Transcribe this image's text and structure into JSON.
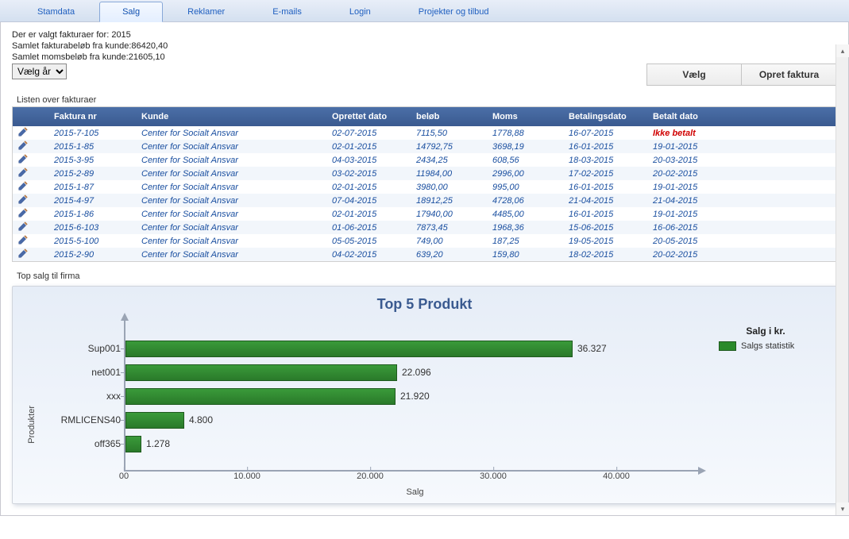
{
  "tabs": [
    {
      "label": "Stamdata",
      "active": false
    },
    {
      "label": "Salg",
      "active": true
    },
    {
      "label": "Reklamer",
      "active": false
    },
    {
      "label": "E-mails",
      "active": false
    },
    {
      "label": "Login",
      "active": false
    },
    {
      "label": "Projekter og tilbud",
      "active": false
    }
  ],
  "info": {
    "selected_year_line": "Der er valgt fakturaer for: 2015",
    "total_invoice": "Samlet fakturabeløb fra kunde:86420,40",
    "total_vat": "Samlet momsbeløb fra kunde:21605,10"
  },
  "year_select": {
    "value": "Vælg år"
  },
  "buttons": {
    "choose": "Vælg",
    "new_invoice": "Opret faktura"
  },
  "list_label": "Listen over fakturaer",
  "columns": {
    "faktura": "Faktura nr",
    "kunde": "Kunde",
    "oprettet": "Oprettet dato",
    "belob": "beløb",
    "moms": "Moms",
    "betalingsdato": "Betalingsdato",
    "betalt": "Betalt dato"
  },
  "not_paid_label": "Ikke betalt",
  "rows": [
    {
      "nr": "2015-7-105",
      "kunde": "Center for Socialt Ansvar",
      "oprettet": "02-07-2015",
      "belob": "7115,50",
      "moms": "1778,88",
      "betd": "16-07-2015",
      "betalt": "Ikke betalt",
      "not_paid": true
    },
    {
      "nr": "2015-1-85",
      "kunde": "Center for Socialt Ansvar",
      "oprettet": "02-01-2015",
      "belob": "14792,75",
      "moms": "3698,19",
      "betd": "16-01-2015",
      "betalt": "19-01-2015"
    },
    {
      "nr": "2015-3-95",
      "kunde": "Center for Socialt Ansvar",
      "oprettet": "04-03-2015",
      "belob": "2434,25",
      "moms": "608,56",
      "betd": "18-03-2015",
      "betalt": "20-03-2015"
    },
    {
      "nr": "2015-2-89",
      "kunde": "Center for Socialt Ansvar",
      "oprettet": "03-02-2015",
      "belob": "11984,00",
      "moms": "2996,00",
      "betd": "17-02-2015",
      "betalt": "20-02-2015"
    },
    {
      "nr": "2015-1-87",
      "kunde": "Center for Socialt Ansvar",
      "oprettet": "02-01-2015",
      "belob": "3980,00",
      "moms": "995,00",
      "betd": "16-01-2015",
      "betalt": "19-01-2015"
    },
    {
      "nr": "2015-4-97",
      "kunde": "Center for Socialt Ansvar",
      "oprettet": "07-04-2015",
      "belob": "18912,25",
      "moms": "4728,06",
      "betd": "21-04-2015",
      "betalt": "21-04-2015"
    },
    {
      "nr": "2015-1-86",
      "kunde": "Center for Socialt Ansvar",
      "oprettet": "02-01-2015",
      "belob": "17940,00",
      "moms": "4485,00",
      "betd": "16-01-2015",
      "betalt": "19-01-2015"
    },
    {
      "nr": "2015-6-103",
      "kunde": "Center for Socialt Ansvar",
      "oprettet": "01-06-2015",
      "belob": "7873,45",
      "moms": "1968,36",
      "betd": "15-06-2015",
      "betalt": "16-06-2015"
    },
    {
      "nr": "2015-5-100",
      "kunde": "Center for Socialt Ansvar",
      "oprettet": "05-05-2015",
      "belob": "749,00",
      "moms": "187,25",
      "betd": "19-05-2015",
      "betalt": "20-05-2015"
    },
    {
      "nr": "2015-2-90",
      "kunde": "Center for Socialt Ansvar",
      "oprettet": "04-02-2015",
      "belob": "639,20",
      "moms": "159,80",
      "betd": "18-02-2015",
      "betalt": "20-02-2015"
    }
  ],
  "top_sales_label": "Top salg til firma",
  "chart_data": {
    "type": "bar",
    "orientation": "horizontal",
    "title": "Top 5 Produkt",
    "xlabel": "Salg",
    "ylabel": "Produkter",
    "xlim": [
      0,
      40000
    ],
    "x_ticks": [
      {
        "value": 0,
        "label": "00"
      },
      {
        "value": 10000,
        "label": "10.000"
      },
      {
        "value": 20000,
        "label": "20.000"
      },
      {
        "value": 30000,
        "label": "30.000"
      },
      {
        "value": 40000,
        "label": "40.000"
      }
    ],
    "categories": [
      "Sup001",
      "net001",
      "xxx",
      "RMLICENS40",
      "off365"
    ],
    "values": [
      36327,
      22096,
      21920,
      4800,
      1278
    ],
    "value_labels": [
      "36.327",
      "22.096",
      "21.920",
      "4.800",
      "1.278"
    ],
    "legend_title": "Salg i kr.",
    "legend_items": [
      "Salgs statistik"
    ]
  }
}
